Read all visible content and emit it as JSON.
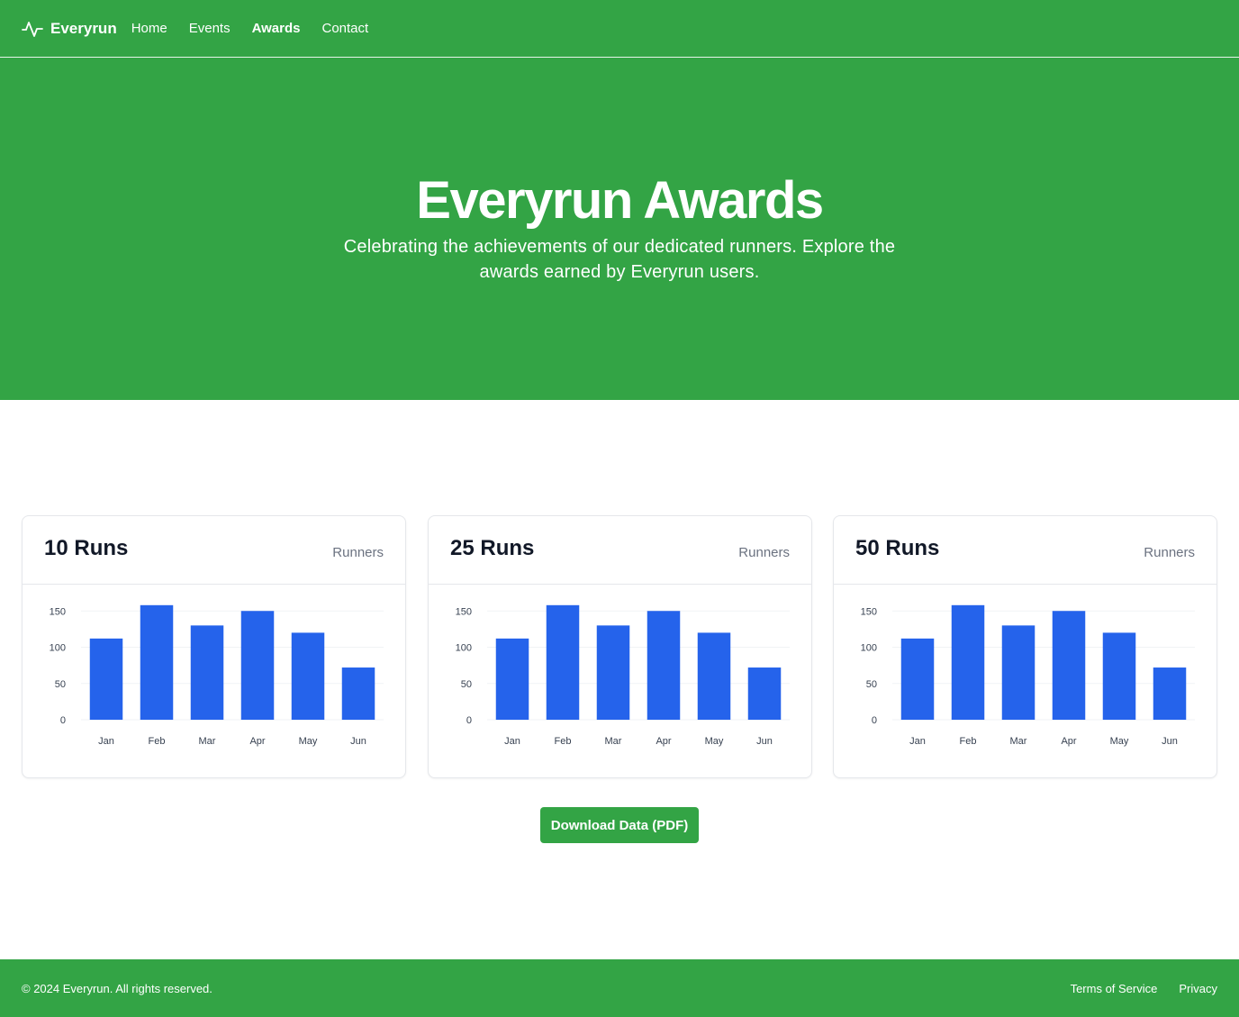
{
  "nav": {
    "brand": "Everyrun",
    "links": [
      {
        "label": "Home"
      },
      {
        "label": "Events"
      },
      {
        "label": "Awards"
      },
      {
        "label": "Contact"
      }
    ]
  },
  "hero": {
    "title": "Everyrun Awards",
    "subtitle": "Celebrating the achievements of our dedicated runners. Explore the awards earned by Everyrun users."
  },
  "colors": {
    "brand_green": "#33a445",
    "bar_blue": "#2563eb"
  },
  "cards": [
    {
      "title": "10 Runs",
      "subtitle": "Runners"
    },
    {
      "title": "25 Runs",
      "subtitle": "Runners"
    },
    {
      "title": "50 Runs",
      "subtitle": "Runners"
    }
  ],
  "chart_data": [
    {
      "type": "bar",
      "categories": [
        "Jan",
        "Feb",
        "Mar",
        "Apr",
        "May",
        "Jun"
      ],
      "values": [
        112,
        158,
        130,
        150,
        120,
        72
      ],
      "ylim": [
        0,
        150
      ],
      "yticks": [
        0,
        50,
        100,
        150
      ],
      "grid": true
    },
    {
      "type": "bar",
      "categories": [
        "Jan",
        "Feb",
        "Mar",
        "Apr",
        "May",
        "Jun"
      ],
      "values": [
        112,
        158,
        130,
        150,
        120,
        72
      ],
      "ylim": [
        0,
        150
      ],
      "yticks": [
        0,
        50,
        100,
        150
      ],
      "grid": true
    },
    {
      "type": "bar",
      "categories": [
        "Jan",
        "Feb",
        "Mar",
        "Apr",
        "May",
        "Jun"
      ],
      "values": [
        112,
        158,
        130,
        150,
        120,
        72
      ],
      "ylim": [
        0,
        150
      ],
      "yticks": [
        0,
        50,
        100,
        150
      ],
      "grid": true
    }
  ],
  "download": {
    "label": "Download Data (PDF)"
  },
  "footer": {
    "copyright": "© 2024 Everyrun. All rights reserved.",
    "links": [
      {
        "label": "Terms of Service"
      },
      {
        "label": "Privacy"
      }
    ]
  }
}
